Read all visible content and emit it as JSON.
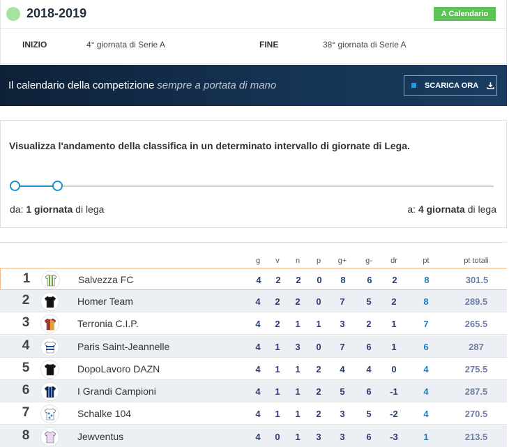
{
  "season": {
    "title": "2018-2019",
    "calendar_button": "A Calendario",
    "start_label": "INIZIO",
    "start_value": "4° giornata di Serie A",
    "end_label": "FINE",
    "end_value": "38° giornata di Serie A"
  },
  "banner": {
    "text": "Il calendario della competizione",
    "text_italic": "sempre a portata di mano",
    "download_button": "SCARICA ORA"
  },
  "range": {
    "title": "Visualizza l'andamento della classifica in un determinato intervallo di giornate di Lega.",
    "from_prefix": "da:",
    "from_value": "1 giornata",
    "from_suffix": "di lega",
    "to_prefix": "a:",
    "to_value": "4 giornata",
    "to_suffix": "di lega"
  },
  "table": {
    "headers": [
      "g",
      "v",
      "n",
      "p",
      "g+",
      "g-",
      "dr",
      "pt",
      "pt totali"
    ],
    "rows": [
      {
        "pos": "1",
        "team": "Salvezza FC",
        "g": "4",
        "v": "2",
        "n": "2",
        "p": "0",
        "gp": "8",
        "gm": "6",
        "dr": "2",
        "pt": "8",
        "tot": "301.5"
      },
      {
        "pos": "2",
        "team": "Homer Team",
        "g": "4",
        "v": "2",
        "n": "2",
        "p": "0",
        "gp": "7",
        "gm": "5",
        "dr": "2",
        "pt": "8",
        "tot": "289.5"
      },
      {
        "pos": "3",
        "team": "Terronia C.I.P.",
        "g": "4",
        "v": "2",
        "n": "1",
        "p": "1",
        "gp": "3",
        "gm": "2",
        "dr": "1",
        "pt": "7",
        "tot": "265.5"
      },
      {
        "pos": "4",
        "team": "Paris Saint-Jeannelle",
        "g": "4",
        "v": "1",
        "n": "3",
        "p": "0",
        "gp": "7",
        "gm": "6",
        "dr": "1",
        "pt": "6",
        "tot": "287"
      },
      {
        "pos": "5",
        "team": "DopoLavoro DAZN",
        "g": "4",
        "v": "1",
        "n": "1",
        "p": "2",
        "gp": "4",
        "gm": "4",
        "dr": "0",
        "pt": "4",
        "tot": "275.5"
      },
      {
        "pos": "6",
        "team": "I Grandi Campioni",
        "g": "4",
        "v": "1",
        "n": "1",
        "p": "2",
        "gp": "5",
        "gm": "6",
        "dr": "-1",
        "pt": "4",
        "tot": "287.5"
      },
      {
        "pos": "7",
        "team": "Schalke 104",
        "g": "4",
        "v": "1",
        "n": "1",
        "p": "2",
        "gp": "3",
        "gm": "5",
        "dr": "-2",
        "pt": "4",
        "tot": "270.5"
      },
      {
        "pos": "8",
        "team": "Jewventus",
        "g": "4",
        "v": "0",
        "n": "1",
        "p": "3",
        "gp": "3",
        "gm": "6",
        "dr": "-3",
        "pt": "1",
        "tot": "213.5"
      }
    ]
  },
  "colors": {
    "calendar_button": "#5cc354",
    "season_dot": "#a7e3a0",
    "banner_dark": "#0e2138",
    "slider_accent": "#1b8ec9",
    "highlight_border": "#f5b988"
  }
}
